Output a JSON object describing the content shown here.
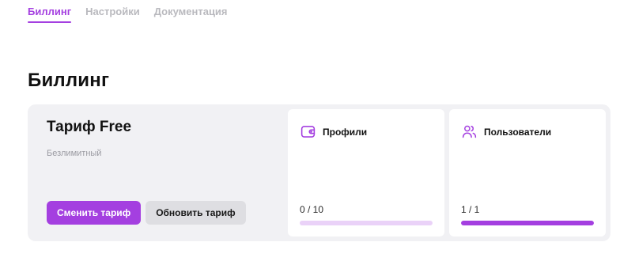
{
  "colors": {
    "accent": "#a43fe0",
    "track": "#ead2f8"
  },
  "tabs": [
    {
      "label": "Биллинг",
      "active": true
    },
    {
      "label": "Настройки",
      "active": false
    },
    {
      "label": "Документация",
      "active": false
    }
  ],
  "page": {
    "title": "Биллинг"
  },
  "plan": {
    "title": "Тариф Free",
    "subtitle": "Безлимитный",
    "change_label": "Сменить тариф",
    "upgrade_label": "Обновить тариф"
  },
  "stats": {
    "profiles": {
      "icon": "wallet-icon",
      "label": "Профили",
      "value_text": "0 / 10",
      "used": 0,
      "total": 10
    },
    "users": {
      "icon": "users-icon",
      "label": "Пользователи",
      "value_text": "1 / 1",
      "used": 1,
      "total": 1
    }
  }
}
